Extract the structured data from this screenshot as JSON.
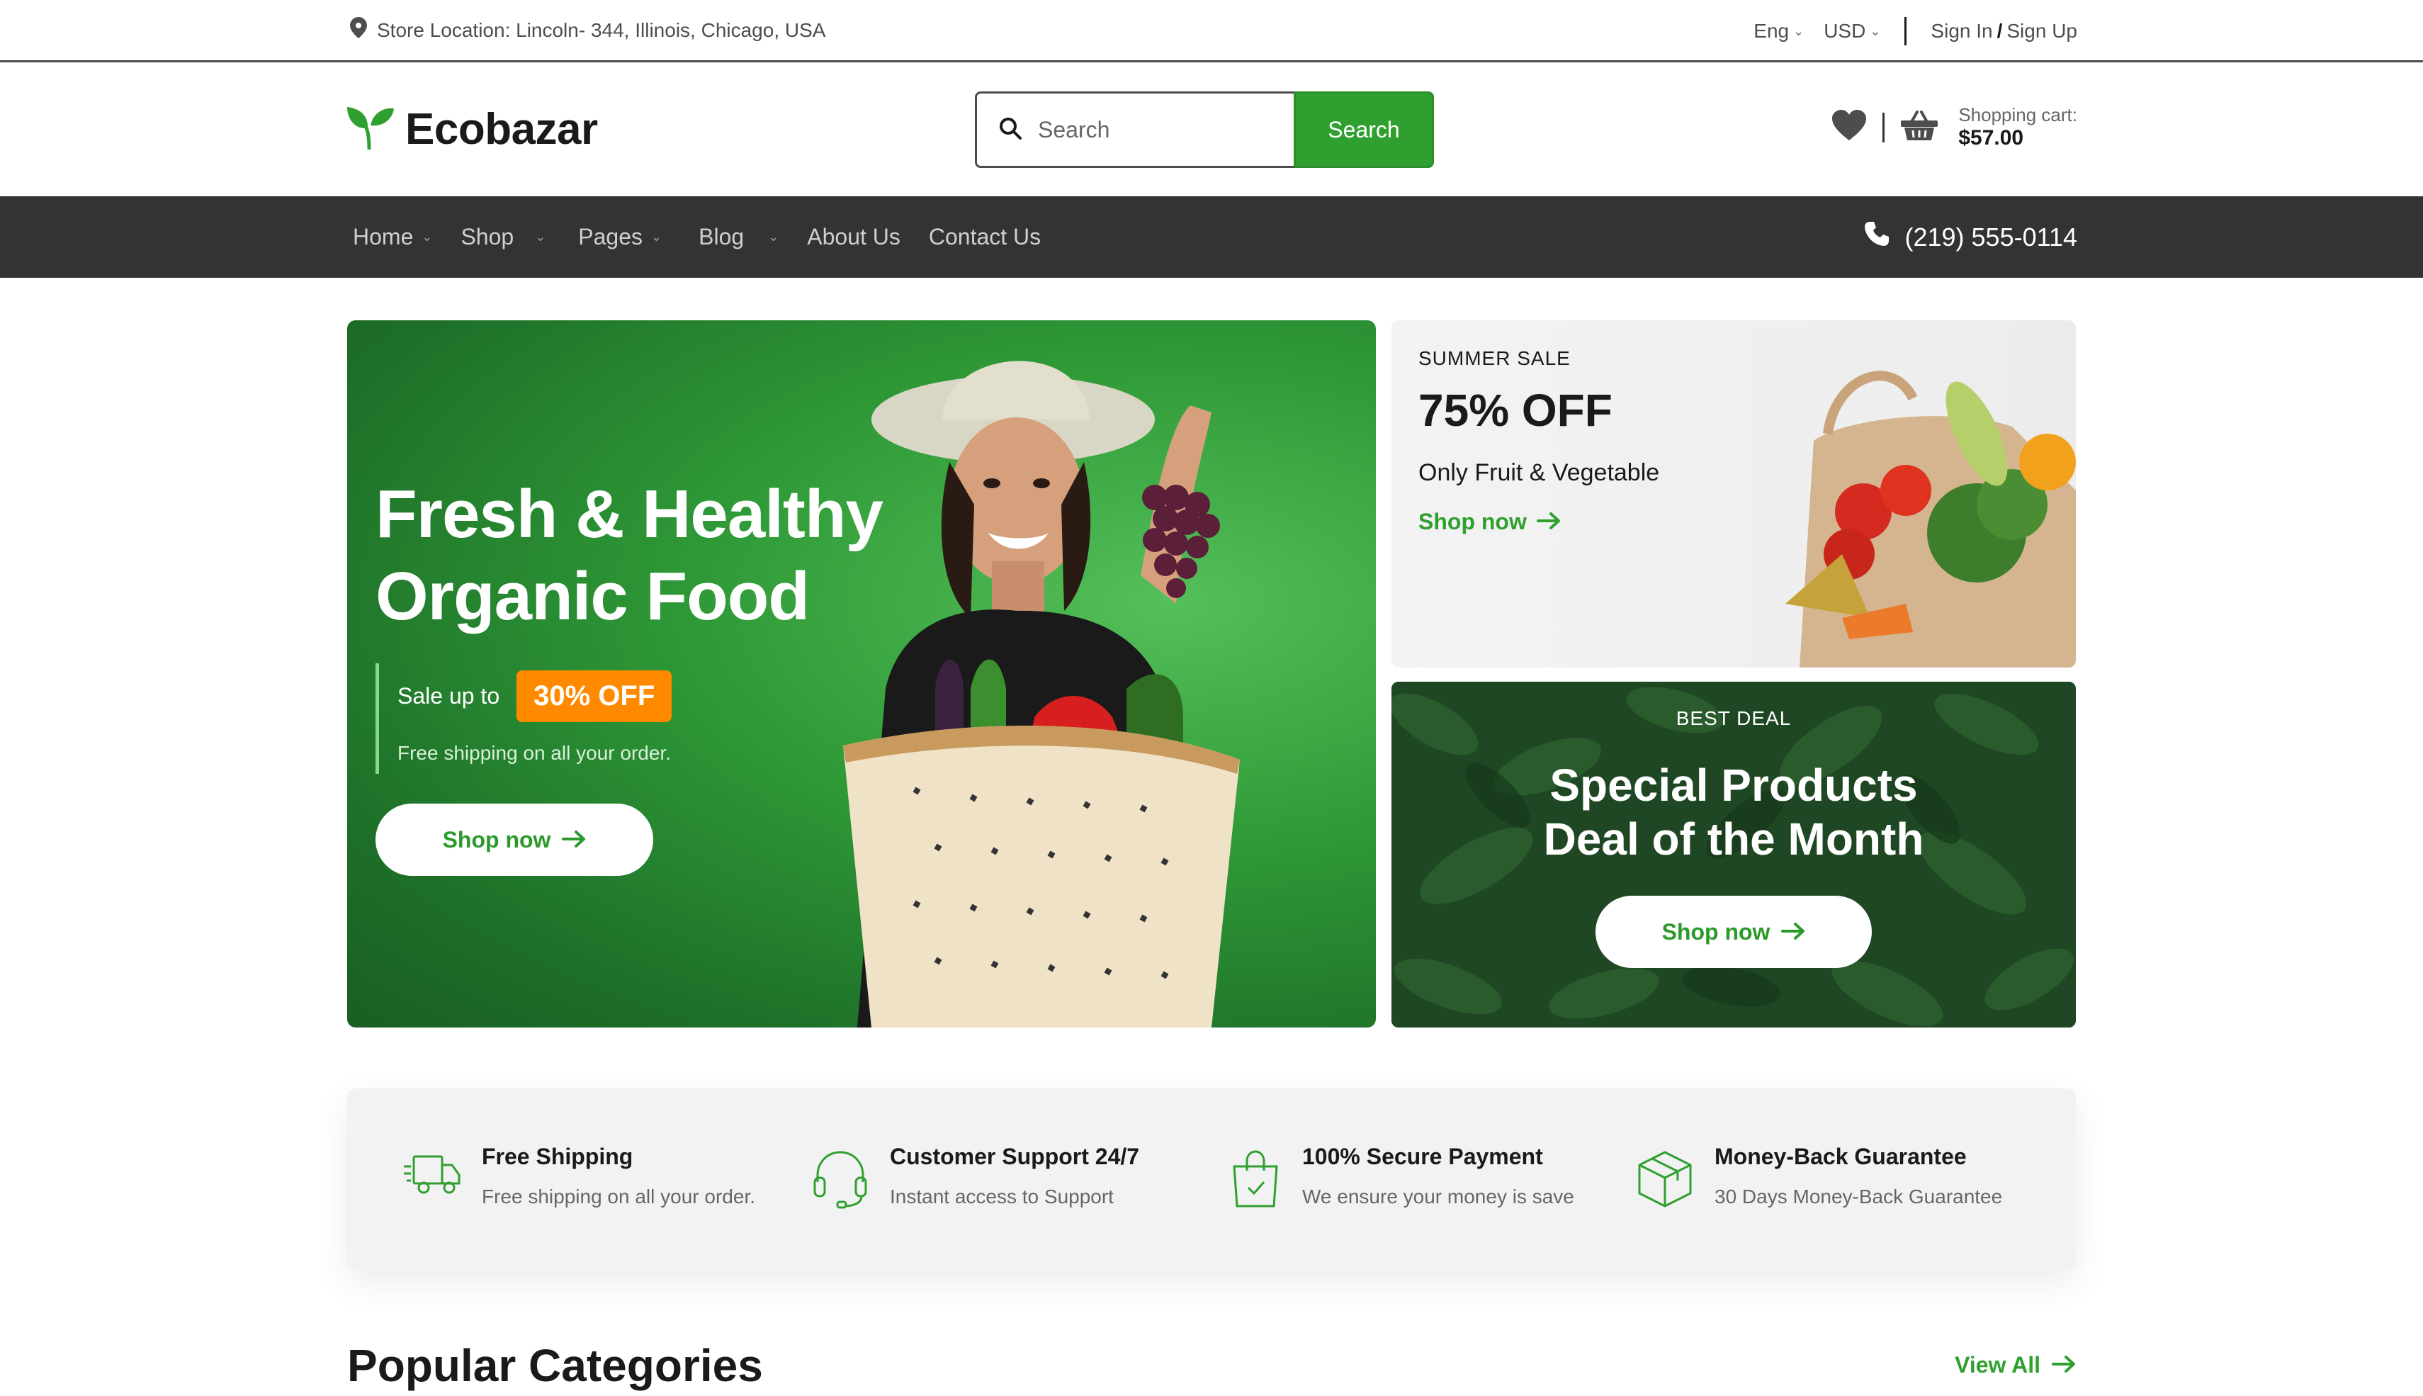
{
  "topbar": {
    "location": "Store Location: Lincoln- 344, Illinois, Chicago, USA",
    "language": "Eng",
    "currency": "USD",
    "sign_in": "Sign In",
    "slash": "/",
    "sign_up": "Sign Up"
  },
  "header": {
    "brand": "Ecobazar",
    "search_placeholder": "Search",
    "search_button": "Search",
    "cart_label": "Shopping cart:",
    "cart_total": "$57.00"
  },
  "nav": {
    "items": [
      {
        "label": "Home"
      },
      {
        "label": "Shop"
      },
      {
        "label": "Pages"
      },
      {
        "label": "Blog"
      },
      {
        "label": "About Us"
      },
      {
        "label": "Contact Us"
      }
    ],
    "phone": "(219) 555-0114"
  },
  "hero": {
    "title_line1": "Fresh & Healthy",
    "title_line2": "Organic Food",
    "sale_text": "Sale up to",
    "sale_badge": "30% OFF",
    "subtitle": "Free shipping on all your order.",
    "cta": "Shop now"
  },
  "summer": {
    "kicker": "SUMMER SALE",
    "headline": "75% OFF",
    "desc": "Only Fruit & Vegetable",
    "cta": "Shop now"
  },
  "deal": {
    "kicker": "BEST DEAL",
    "headline_line1": "Special Products",
    "headline_line2": "Deal of the Month",
    "cta": "Shop now"
  },
  "features": [
    {
      "title": "Free Shipping",
      "subtitle": "Free shipping on all your order.",
      "icon": "truck-icon"
    },
    {
      "title": "Customer Support 24/7",
      "subtitle": "Instant access to Support",
      "icon": "headphones-icon"
    },
    {
      "title": "100% Secure Payment",
      "subtitle": "We ensure your money is save",
      "icon": "shopping-bag-icon"
    },
    {
      "title": "Money-Back Guarantee",
      "subtitle": "30 Days Money-Back Guarantee",
      "icon": "box-icon"
    }
  ],
  "popular": {
    "title": "Popular Categories",
    "view_all": "View All"
  },
  "colors": {
    "primary": "#2fa02f",
    "dark_nav": "#333333",
    "badge": "#ff8a00"
  }
}
